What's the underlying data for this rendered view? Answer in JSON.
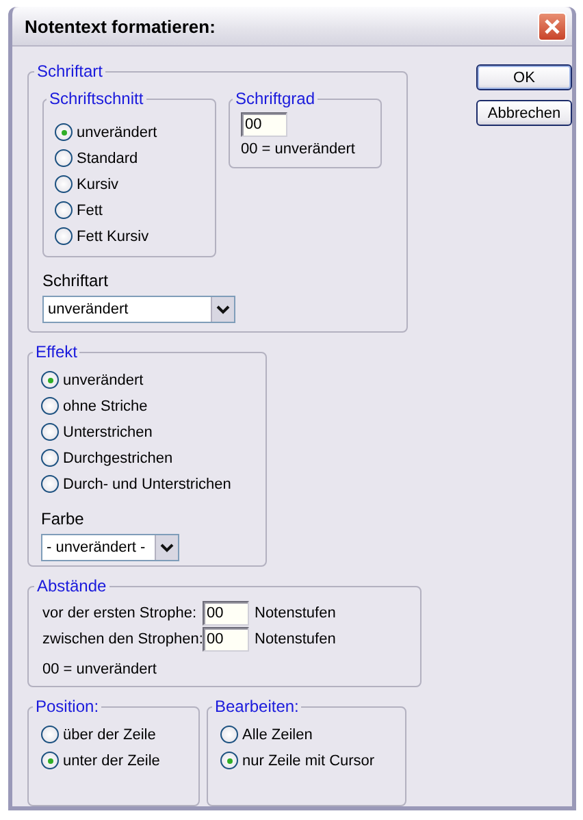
{
  "window": {
    "title": "Notentext formatieren:"
  },
  "buttons": [
    {
      "label": "OK",
      "default": true
    },
    {
      "label": "Abbrechen",
      "default": false
    }
  ],
  "schriftart": {
    "title": "Schriftart",
    "schriftschnitt": {
      "title": "Schriftschnitt",
      "options": [
        {
          "label": "unverändert",
          "selected": true
        },
        {
          "label": "Standard",
          "selected": false
        },
        {
          "label": "Kursiv",
          "selected": false
        },
        {
          "label": "Fett",
          "selected": false
        },
        {
          "label": "Fett Kursiv",
          "selected": false
        }
      ]
    },
    "schriftgrad": {
      "title": "Schriftgrad",
      "value": "00",
      "hint": "00 = unverändert"
    },
    "font_label": "Schriftart",
    "font_value": "unverändert"
  },
  "effekt": {
    "title": "Effekt",
    "options": [
      {
        "label": "unverändert",
        "selected": true
      },
      {
        "label": "ohne Striche",
        "selected": false
      },
      {
        "label": "Unterstrichen",
        "selected": false
      },
      {
        "label": "Durchgestrichen",
        "selected": false
      },
      {
        "label": "Durch- und Unterstrichen",
        "selected": false
      }
    ],
    "color_label": "Farbe",
    "color_value": "- unverändert -"
  },
  "abstaende": {
    "title": "Abstände",
    "rows": [
      {
        "label": "vor der ersten Strophe:",
        "value": "00",
        "unit": "Notenstufen"
      },
      {
        "label": "zwischen den Strophen:",
        "value": "00",
        "unit": "Notenstufen"
      }
    ],
    "hint": "00 = unverändert"
  },
  "position": {
    "title": "Position:",
    "options": [
      {
        "label": "über der Zeile",
        "selected": false
      },
      {
        "label": "unter der Zeile",
        "selected": true
      }
    ]
  },
  "bearbeiten": {
    "title": "Bearbeiten:",
    "options": [
      {
        "label": "Alle Zeilen",
        "selected": false
      },
      {
        "label": "nur Zeile mit Cursor",
        "selected": true
      }
    ]
  }
}
